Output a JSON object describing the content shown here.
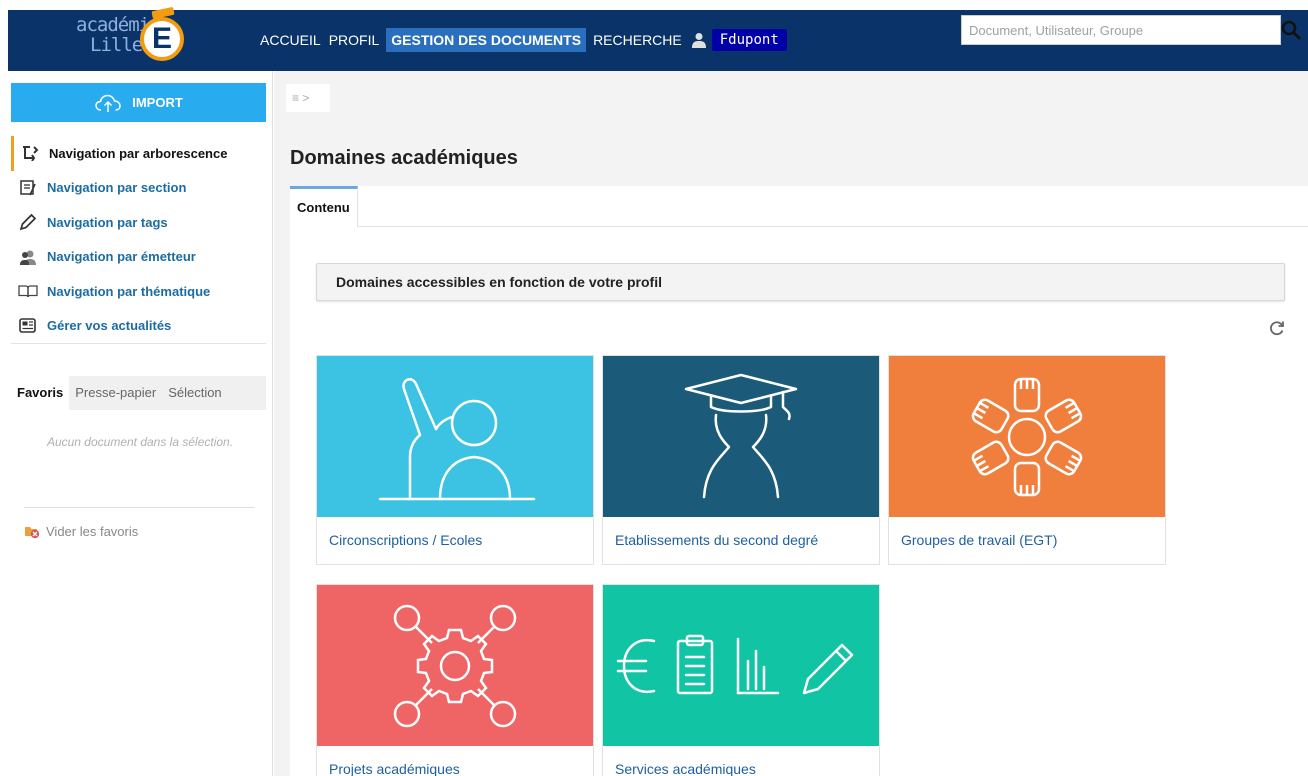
{
  "header": {
    "logo_line1": "académie",
    "logo_line2": "Lille",
    "logo_letter": "E",
    "nav": [
      "ACCUEIL",
      "PROFIL",
      "GESTION DES DOCUMENTS",
      "RECHERCHE"
    ],
    "user_name": "Fdupont",
    "search_placeholder": "Document, Utilisateur, Groupe"
  },
  "sidebar": {
    "import_label": "IMPORT",
    "nav_items": [
      {
        "label": "Navigation par arborescence",
        "icon": "tree-icon",
        "active": true
      },
      {
        "label": "Navigation par section",
        "icon": "section-icon"
      },
      {
        "label": "Navigation par tags",
        "icon": "tag-pencil-icon"
      },
      {
        "label": "Navigation par émetteur",
        "icon": "sender-icon"
      },
      {
        "label": "Navigation par thématique",
        "icon": "book-icon"
      },
      {
        "label": "Gérer vos actualités",
        "icon": "news-icon"
      }
    ],
    "fav_tabs": [
      "Favoris",
      "Presse-papier",
      "Sélection"
    ],
    "fav_empty": "Aucun document dans la sélection.",
    "fav_clear": "Vider les favoris"
  },
  "main": {
    "breadcrumb": "≡ >",
    "page_title": "Domaines académiques",
    "tab_label": "Contenu",
    "section_header": "Domaines accessibles en fonction de votre profil",
    "tiles": [
      {
        "label": "Circonscriptions / Ecoles",
        "color": "#3cc3e3",
        "icon": "raised-hand-icon"
      },
      {
        "label": "Etablissements du second degré",
        "color": "#1b5b79",
        "icon": "graduate-icon"
      },
      {
        "label": "Groupes de travail (EGT)",
        "color": "#f07f3e",
        "icon": "teamwork-hands-icon"
      },
      {
        "label": "Projets académiques",
        "color": "#ef6464",
        "icon": "gear-network-icon"
      },
      {
        "label": "Services académiques",
        "color": "#10c4a4",
        "icon": "services-icon"
      }
    ]
  },
  "colors": {
    "header_bg": "#0a3469",
    "nav_active": "#2a6fbd",
    "import_btn": "#29abf0",
    "link": "#1c6ca3"
  }
}
